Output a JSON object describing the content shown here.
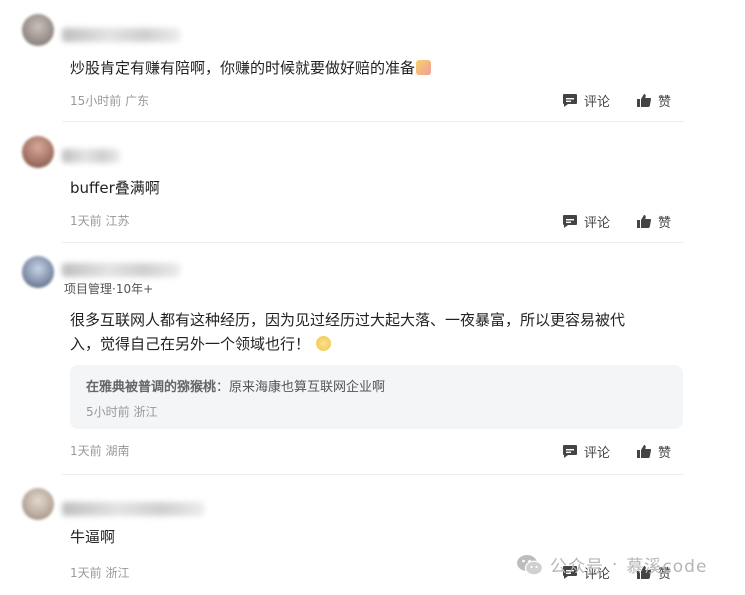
{
  "comments": [
    {
      "text": "炒股肯定有赚有陪啊，你赚的时候就要做好赔的准备",
      "emoji": "party-emoji",
      "time": "15小时前",
      "region": "广东",
      "reply_label": "评论",
      "like_label": "赞"
    },
    {
      "text": "buffer叠满啊",
      "time": "1天前",
      "region": "江苏",
      "reply_label": "评论",
      "like_label": "赞"
    },
    {
      "user_tag": "项目管理·10年+",
      "text_line1": "很多互联网人都有这种经历，因为见过经历过大起大落、一夜暴富，所以更容易被代",
      "text_line2": "入，觉得自己在另外一个领域也行！",
      "emoji": "smile-emoji",
      "time": "1天前",
      "region": "湖南",
      "reply_label": "评论",
      "like_label": "赞",
      "nested_reply": {
        "user": "在雅典被普调的猕猴桃",
        "separator": "：",
        "text": "原来海康也算互联网企业啊",
        "time": "5小时前",
        "region": "浙江"
      }
    },
    {
      "text": "牛逼啊",
      "time": "1天前",
      "region": "浙江",
      "reply_label": "评论",
      "like_label": "赞"
    }
  ],
  "watermark": {
    "icon": "wechat-icon",
    "label": "公众号",
    "separator": "·",
    "name": "慕溪code"
  },
  "colors": {
    "text": "#222222",
    "meta": "#999999",
    "reply_bg": "#f4f5f7",
    "watermark": "#b5b5b5"
  }
}
